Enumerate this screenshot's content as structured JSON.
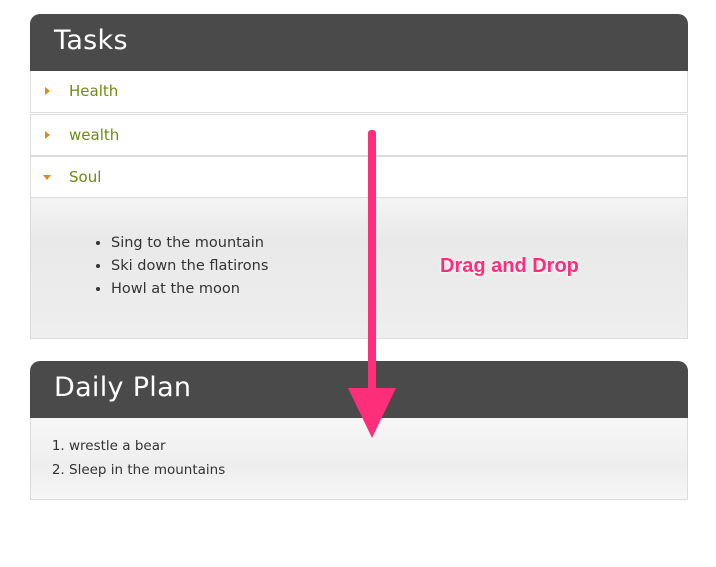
{
  "tasks_panel": {
    "title": "Tasks",
    "sections": [
      {
        "label": "Health",
        "expanded": false
      },
      {
        "label": "wealth",
        "expanded": false
      },
      {
        "label": "Soul",
        "expanded": true
      }
    ],
    "soul_items": [
      "Sing to the mountain",
      "Ski down the flatirons",
      "Howl at the moon"
    ]
  },
  "plan_panel": {
    "title": "Daily Plan",
    "items": [
      "wrestle a bear",
      "Sleep in the mountains"
    ]
  },
  "annotation": {
    "label": "Drag and Drop",
    "color": "#ff2e7a"
  },
  "colors": {
    "header_bg": "#4a4a4a",
    "section_label": "#6f8a12",
    "arrow_icon": "#e08a1c"
  }
}
